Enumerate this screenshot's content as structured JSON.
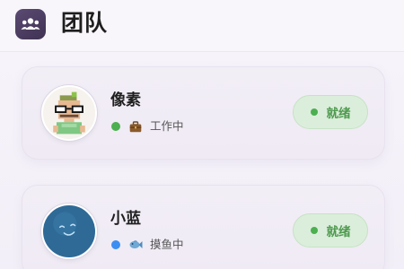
{
  "header": {
    "icon": "team-icon",
    "title": "团队"
  },
  "members": [
    {
      "name": "像素",
      "avatar": "pixel-character-avatar",
      "status_color": "#4caf50",
      "status_icon": "briefcase-icon",
      "status_text": "工作中",
      "action_label": "就绪"
    },
    {
      "name": "小蓝",
      "avatar": "blue-blob-avatar",
      "status_color": "#3d8ef2",
      "status_icon": "fish-icon",
      "status_text": "摸鱼中",
      "action_label": "就绪"
    }
  ],
  "colors": {
    "accent_dark": "#4a3b5e",
    "ready_green": "#4caf50",
    "ready_bg": "#dbeedb"
  }
}
